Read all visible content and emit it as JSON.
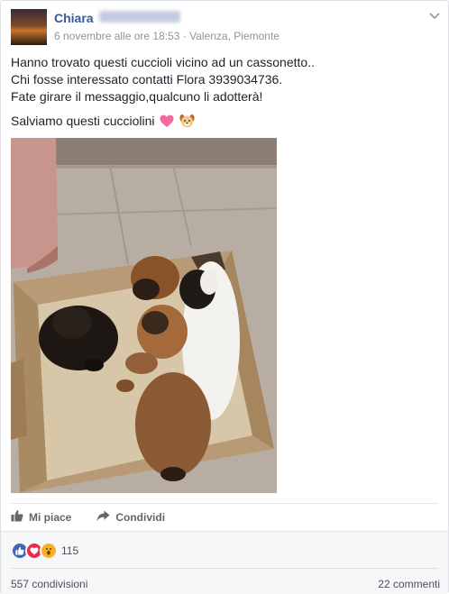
{
  "post": {
    "author": "Chiara",
    "timestamp": "6 novembre alle ore 18:53",
    "separator": "·",
    "location": "Valenza, Piemonte",
    "lines": [
      "Hanno trovato questi cuccioli vicino ad un cassonetto..",
      "Chi fosse interessato contatti Flora 3939034736.",
      "Fate girare il messaggio,qualcuno li adotterà!"
    ],
    "closing": "Salviamo questi cucciolini",
    "closing_emojis": [
      "heart-emoji",
      "dog-face-emoji"
    ]
  },
  "actions": {
    "like_label": "Mi piace",
    "share_label": "Condividi"
  },
  "stats": {
    "reactions_count": "115",
    "reaction_icons": [
      "like-reaction-icon",
      "love-reaction-icon",
      "wow-reaction-icon"
    ],
    "shares": "557 condivisioni",
    "comments": "22 commenti"
  },
  "colors": {
    "link": "#365899",
    "like_blue": "#4267b2",
    "love_red": "#f0284a",
    "wow_yellow": "#f7b125"
  }
}
